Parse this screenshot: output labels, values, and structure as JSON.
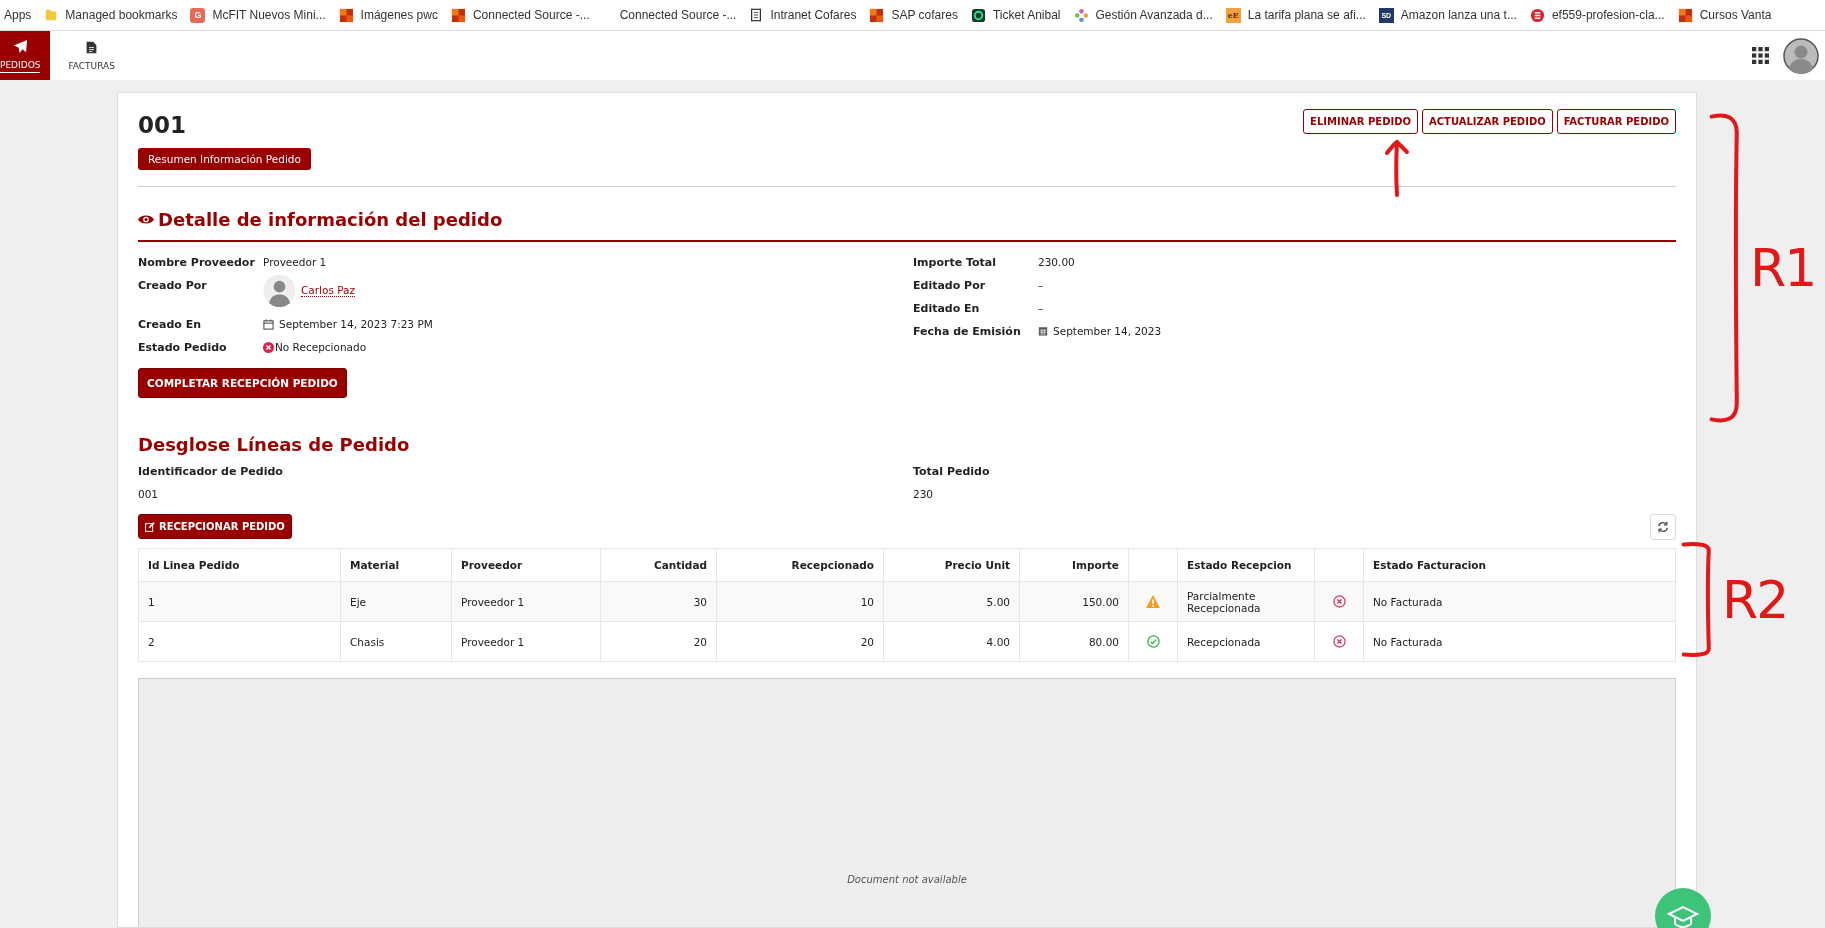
{
  "bookmarks": [
    {
      "label": "Apps",
      "kind": "none"
    },
    {
      "label": "Managed bookmarks",
      "kind": "folder"
    },
    {
      "label": "McFIT Nuevos Mini...",
      "kind": "letter",
      "icon_text": "G"
    },
    {
      "label": "Imágenes pwc",
      "kind": "tiles"
    },
    {
      "label": "Connected Source -...",
      "kind": "tiles"
    },
    {
      "label": "Connected Source -...",
      "kind": "none"
    },
    {
      "label": "Intranet Cofares",
      "kind": "page"
    },
    {
      "label": "SAP cofares",
      "kind": "tiles"
    },
    {
      "label": "Ticket Anibal",
      "kind": "ring"
    },
    {
      "label": "Gestión Avanzada d...",
      "kind": "flower"
    },
    {
      "label": "La tarifa plana se afi...",
      "kind": "square-text",
      "icon_text": "eE"
    },
    {
      "label": "Amazon lanza una t...",
      "kind": "dark-text",
      "icon_text": "SD"
    },
    {
      "label": "ef559-profesion-cla...",
      "kind": "round"
    },
    {
      "label": "Cursos Vanta",
      "kind": "tiles"
    }
  ],
  "nav": {
    "tabs": [
      {
        "label": "PEDIDOS",
        "kind": "plane",
        "selected": true
      },
      {
        "label": "FACTURAS",
        "kind": "invoice",
        "selected": false
      }
    ]
  },
  "order": {
    "title": "001",
    "summary_tag": "Resumen Información Pedido",
    "actions": [
      "ELIMINAR PEDIDO",
      "ACTUALIZAR PEDIDO",
      "FACTURAR PEDIDO"
    ],
    "detail_heading": "Detalle de información del pedido",
    "left_fields": [
      {
        "label": "Nombre Proveedor",
        "value": "Proveedor 1",
        "kind": "text"
      },
      {
        "label": "Creado Por",
        "value": "Carlos Paz",
        "kind": "user"
      },
      {
        "label": "Creado En",
        "value": "September 14, 2023 7:23 PM",
        "kind": "date"
      },
      {
        "label": "Estado Pedido",
        "value": "No Recepcionado",
        "kind": "status"
      }
    ],
    "right_fields": [
      {
        "label": "Importe Total",
        "value": "230.00",
        "kind": "text"
      },
      {
        "label": "Editado Por",
        "value": "–",
        "kind": "text"
      },
      {
        "label": "Editado En",
        "value": "–",
        "kind": "text"
      },
      {
        "label": "Fecha de Emisión",
        "value": "September 14, 2023",
        "kind": "calendar"
      }
    ],
    "complete_button": "COMPLETAR RECEPCIÓN PEDIDO"
  },
  "lines": {
    "heading": "Desglose Líneas de Pedido",
    "summary": [
      {
        "label": "Identificador de Pedido",
        "value": "001"
      },
      {
        "label": "Total Pedido",
        "value": "230"
      }
    ],
    "receive_button": "RECEPCIONAR PEDIDO",
    "table": {
      "columns": [
        "Id Linea Pedido",
        "Material",
        "Proveedor",
        "Cantidad",
        "Recepcionado",
        "Precio Unit",
        "Importe",
        "Estado Recepcion",
        "Estado Facturacion"
      ],
      "rows": [
        {
          "id": "1",
          "material": "Eje",
          "proveedor": "Proveedor 1",
          "cantidad": "30",
          "recepcionado": "10",
          "precio": "5.00",
          "importe": "150.00",
          "reception": {
            "kind": "partial",
            "text": "Parcialmente Recepcionada"
          },
          "invoice": {
            "kind": "none",
            "text": "No Facturada"
          }
        },
        {
          "id": "2",
          "material": "Chasis",
          "proveedor": "Proveedor 1",
          "cantidad": "20",
          "recepcionado": "20",
          "precio": "4.00",
          "importe": "80.00",
          "reception": {
            "kind": "complete",
            "text": "Recepcionada"
          },
          "invoice": {
            "kind": "none",
            "text": "No Facturada"
          }
        }
      ]
    }
  },
  "document": {
    "message": "Document not available"
  },
  "annotations": [
    {
      "kind": "arrow"
    },
    {
      "kind": "bracket",
      "label": "R1"
    },
    {
      "kind": "bracket",
      "label": "R2"
    }
  ]
}
